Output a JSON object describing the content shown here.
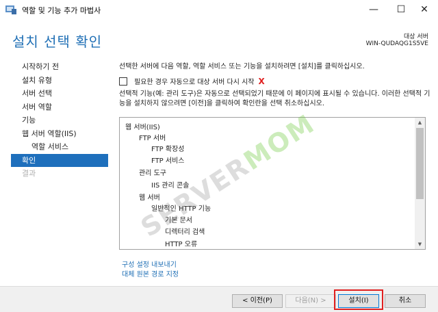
{
  "window": {
    "title": "역할 및 기능 추가 마법사",
    "minimize_glyph": "—",
    "maximize_glyph": "☐",
    "close_glyph": "✕"
  },
  "header": {
    "page_title": "설치 선택 확인",
    "dest_label": "대상 서버",
    "dest_server": "WIN-QUDAQG1S5VE"
  },
  "nav": {
    "items": [
      {
        "label": "시작하기 전",
        "state": "normal"
      },
      {
        "label": "설치 유형",
        "state": "normal"
      },
      {
        "label": "서버 선택",
        "state": "normal"
      },
      {
        "label": "서버 역할",
        "state": "normal"
      },
      {
        "label": "기능",
        "state": "normal"
      },
      {
        "label": "웹 서버 역할(IIS)",
        "state": "normal"
      },
      {
        "label": "역할 서비스",
        "state": "sub"
      },
      {
        "label": "확인",
        "state": "active"
      },
      {
        "label": "결과",
        "state": "disabled"
      }
    ]
  },
  "content": {
    "intro": "선택한 서버에 다음 역할, 역할 서비스 또는 기능을 설치하려면 [설치]를 클릭하십시오.",
    "restart_label": "필요한 경우 자동으로 대상 서버 다시 시작",
    "restart_mark": "X",
    "note": "선택적 기능(예: 관리 도구)은 자동으로 선택되었기 때문에 이 페이지에 표시될 수 있습니다. 이러한 선택적 기능을 설치하지 않으려면 [이전]을 클릭하여 확인란을 선택 취소하십시오."
  },
  "features": [
    {
      "label": "웹 서버(IIS)",
      "level": 0
    },
    {
      "label": "FTP 서버",
      "level": 1
    },
    {
      "label": "FTP 확장성",
      "level": 2
    },
    {
      "label": "FTP 서비스",
      "level": 2
    },
    {
      "label": "관리 도구",
      "level": 1
    },
    {
      "label": "IIS 관리 콘솔",
      "level": 2
    },
    {
      "label": "웹 서버",
      "level": 1
    },
    {
      "label": "일반적인 HTTP 기능",
      "level": 2
    },
    {
      "label": "기본 문서",
      "level": 3
    },
    {
      "label": "디렉터리 검색",
      "level": 3
    },
    {
      "label": "HTTP 오류",
      "level": 3
    }
  ],
  "scroll": {
    "up_glyph": "▲",
    "down_glyph": "▼"
  },
  "links": {
    "export": "구성 설정 내보내기",
    "alt_source": "대체 원본 경로 지정"
  },
  "footer": {
    "prev": "< 이전(P)",
    "next": "다음(N) >",
    "install": "설치(I)",
    "cancel": "취소"
  },
  "watermark": {
    "text_a": "SERVER",
    "text_b": "MOM"
  },
  "colors": {
    "accent": "#1f6fb5",
    "nav_active": "#1e6fbc",
    "highlight": "#e02020"
  }
}
